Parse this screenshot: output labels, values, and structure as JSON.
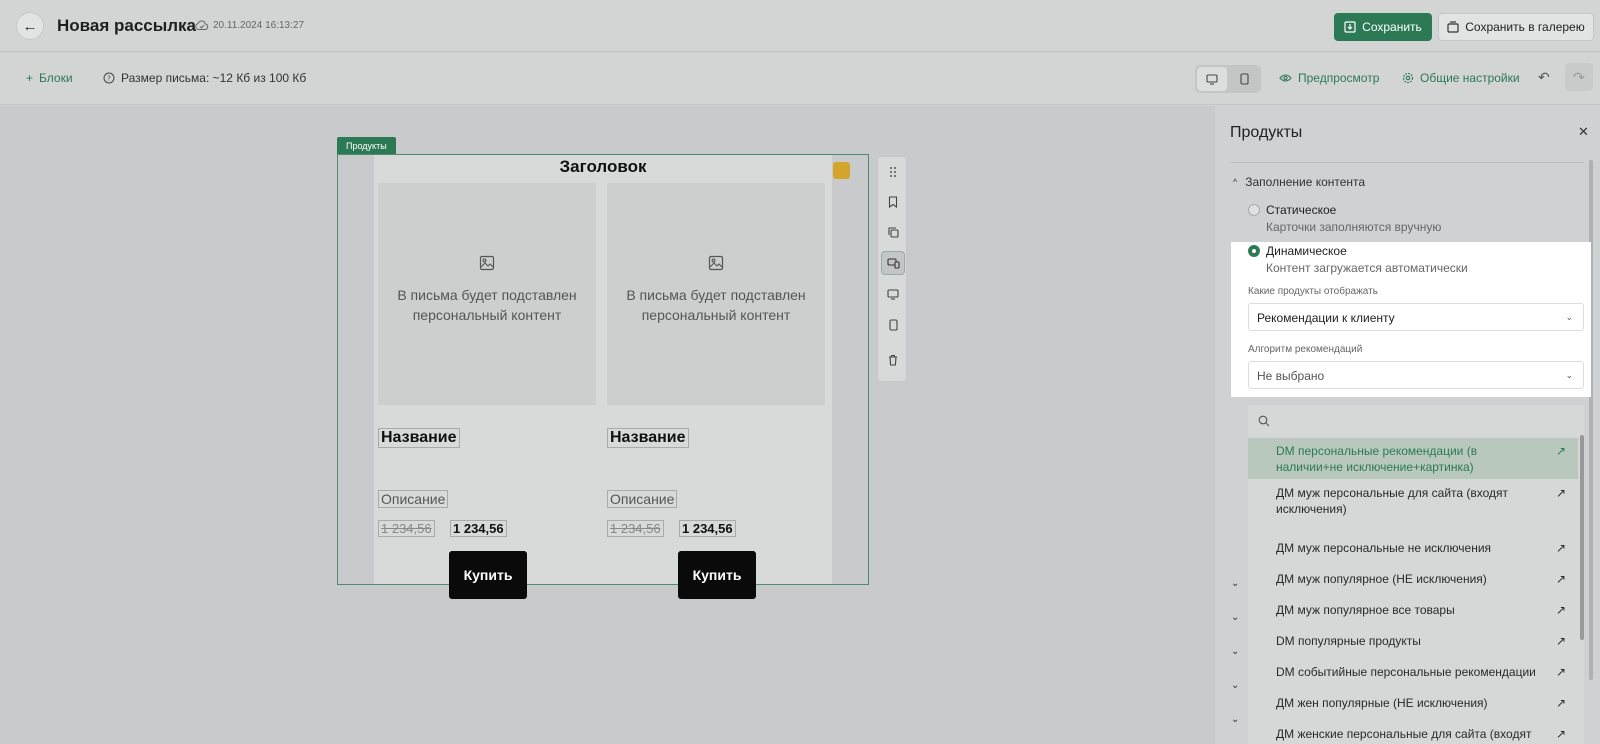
{
  "header": {
    "back_icon": "arrow-left-icon",
    "title": "Новая рассылка",
    "cloud_icon": "cloud-check-icon",
    "saved_at": "20.11.2024 16:13:27",
    "save_label": "Сохранить",
    "save_gallery_label": "Сохранить в галерею",
    "accent": "#2c7a55"
  },
  "toolbar": {
    "blocks_label": "Блоки",
    "size_label": "Размер письма: ~12 Кб из 100 Кб",
    "preview_label": "Предпросмотр",
    "settings_label": "Общие настройки"
  },
  "canvas": {
    "block_tag": "Продукты",
    "email_title": "Заголовок",
    "cards": [
      {
        "placeholder": "В письма будет подставлен персональный контент",
        "name": "Название",
        "description": "Описание",
        "old_price": "1 234,56",
        "price": "1 234,56",
        "buy": "Купить"
      },
      {
        "placeholder": "В письма будет подставлен персональный контент",
        "name": "Название",
        "description": "Описание",
        "old_price": "1 234,56",
        "price": "1 234,56",
        "buy": "Купить"
      }
    ]
  },
  "panel": {
    "title": "Продукты",
    "section": "Заполнение контента",
    "static_label": "Статическое",
    "static_sub": "Карточки заполняются вручную",
    "dynamic_label": "Динамическое",
    "dynamic_sub": "Контент загружается автоматически",
    "products_label": "Какие продукты отображать",
    "products_value": "Рекомендации к клиенту",
    "algo_label": "Алгоритм рекомендаций",
    "algo_value": "Не выбрано",
    "options": [
      "DM персональные рекомендации (в наличии+не исключение+картинка)",
      "ДМ муж персональные для сайта (входят исключения)",
      "ДМ муж персональные не исключения",
      "ДМ муж популярное (НЕ исключения)",
      "ДМ муж популярное все товары",
      "DM популярные продукты",
      "DM событийные персональные рекомендации",
      "ДМ жен популярные (НЕ исключения)",
      "ДМ женские персональные для сайта (входят"
    ]
  }
}
